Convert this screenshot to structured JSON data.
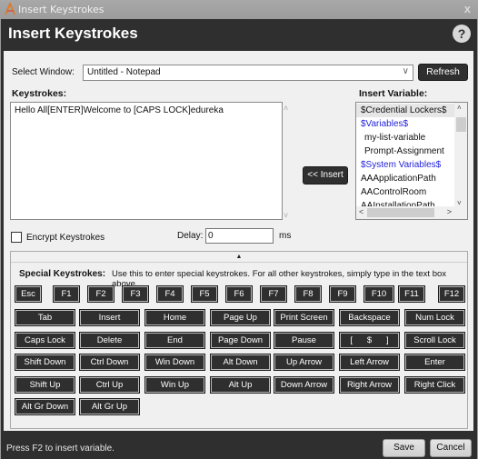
{
  "window": {
    "title": "Insert Keystrokes",
    "app_icon": "automation-anywhere-logo",
    "close_glyph": "x"
  },
  "header": {
    "title": "Insert Keystrokes",
    "help_glyph": "?"
  },
  "select_window": {
    "label": "Select Window:",
    "value": "Untitled - Notepad",
    "chevron": "∨",
    "refresh_label": "Refresh"
  },
  "keystrokes": {
    "label": "Keystrokes:",
    "value": "Hello All[ENTER]Welcome to [CAPS LOCK]edureka",
    "scroll_up": "˄",
    "scroll_down": "˅"
  },
  "insert_button": {
    "label": "<< Insert"
  },
  "insert_variable": {
    "label": "Insert Variable:",
    "items": [
      {
        "label": "$Credential Lockers$",
        "kind": "selected"
      },
      {
        "label": "$Variables$",
        "kind": "header"
      },
      {
        "label": "my-list-variable",
        "kind": "sub"
      },
      {
        "label": "Prompt-Assignment",
        "kind": "sub"
      },
      {
        "label": "$System Variables$",
        "kind": "header"
      },
      {
        "label": "AAApplicationPath",
        "kind": "item"
      },
      {
        "label": "AAControlRoom",
        "kind": "item"
      },
      {
        "label": "AAInstallationPath",
        "kind": "item"
      }
    ],
    "scroll_up": "˄",
    "scroll_down": "˅",
    "scroll_left": "<",
    "scroll_right": ">"
  },
  "options": {
    "encrypt_label": "Encrypt Keystrokes",
    "encrypt_checked": false,
    "delay_label": "Delay:",
    "delay_value": "0",
    "delay_unit": "ms"
  },
  "special_keystrokes": {
    "collapse_glyph": "▲",
    "label": "Special Keystrokes:",
    "description": "Use this to enter special keystrokes. For all other keystrokes, simply type in the text box above.",
    "function_row": [
      "Esc",
      "F1",
      "F2",
      "F3",
      "F4",
      "F5",
      "F6",
      "F7",
      "F8",
      "F9",
      "F10",
      "F11",
      "F12"
    ],
    "rows": [
      [
        "Tab",
        "Insert",
        "Home",
        "Page Up",
        "Print Screen",
        "Backspace",
        "Num Lock"
      ],
      [
        "Caps Lock",
        "Delete",
        "End",
        "Page Down",
        "Pause",
        "[      $      ]",
        "Scroll Lock"
      ],
      [
        "Shift Down",
        "Ctrl Down",
        "Win Down",
        "Alt Down",
        "Up Arrow",
        "Left Arrow",
        "Enter"
      ],
      [
        "Shift Up",
        "Ctrl Up",
        "Win Up",
        "Alt Up",
        "Down Arrow",
        "Right Arrow",
        "Right Click"
      ],
      [
        "Alt Gr Down",
        "Alt Gr Up"
      ]
    ]
  },
  "footer": {
    "hint": "Press F2 to insert variable.",
    "save_label": "Save",
    "cancel_label": "Cancel"
  }
}
